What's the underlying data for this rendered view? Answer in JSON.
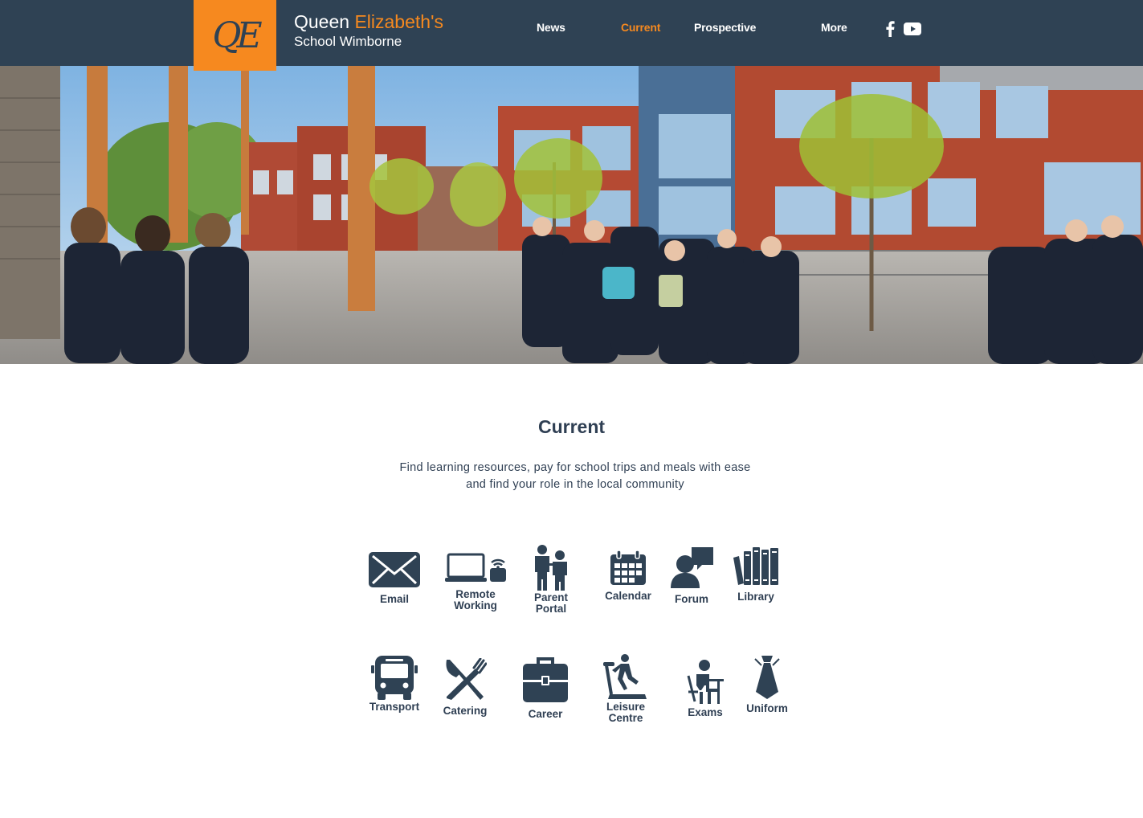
{
  "header": {
    "logo_text": "QE",
    "brand_first": "Queen ",
    "brand_accent": "Elizabeth's",
    "brand_sub": "School Wimborne"
  },
  "nav": {
    "items": [
      {
        "label": "News",
        "active": false
      },
      {
        "label": "Current",
        "active": true
      },
      {
        "label": "Prospective",
        "active": false
      },
      {
        "label": "More",
        "active": false
      }
    ]
  },
  "social": [
    {
      "icon": "facebook-icon"
    },
    {
      "icon": "youtube-icon"
    }
  ],
  "hero": {
    "icon": "school-courtyard-photo"
  },
  "main": {
    "title": "Current",
    "intro_line1": "Find learning resources, pay for school trips and meals with ease",
    "intro_line2": "and find your role in the local community"
  },
  "tiles": [
    {
      "label": "Email",
      "icon": "envelope-icon"
    },
    {
      "label": "Remote\nWorking",
      "icon": "laptop-wifi-icon"
    },
    {
      "label": "Parent\nPortal",
      "icon": "parent-child-icon"
    },
    {
      "label": "Calendar",
      "icon": "calendar-icon"
    },
    {
      "label": "Forum",
      "icon": "speech-person-icon"
    },
    {
      "label": "Library",
      "icon": "books-icon"
    },
    {
      "label": "Transport",
      "icon": "bus-icon"
    },
    {
      "label": "Catering",
      "icon": "cutlery-icon"
    },
    {
      "label": "Career",
      "icon": "briefcase-icon"
    },
    {
      "label": "Leisure\nCentre",
      "icon": "treadmill-icon"
    },
    {
      "label": "Exams",
      "icon": "student-desk-icon"
    },
    {
      "label": "Uniform",
      "icon": "tie-icon"
    }
  ],
  "colors": {
    "header_bg": "#2f4254",
    "accent": "#f6891f",
    "icon": "#2f4254",
    "text": "#2f3f53"
  }
}
